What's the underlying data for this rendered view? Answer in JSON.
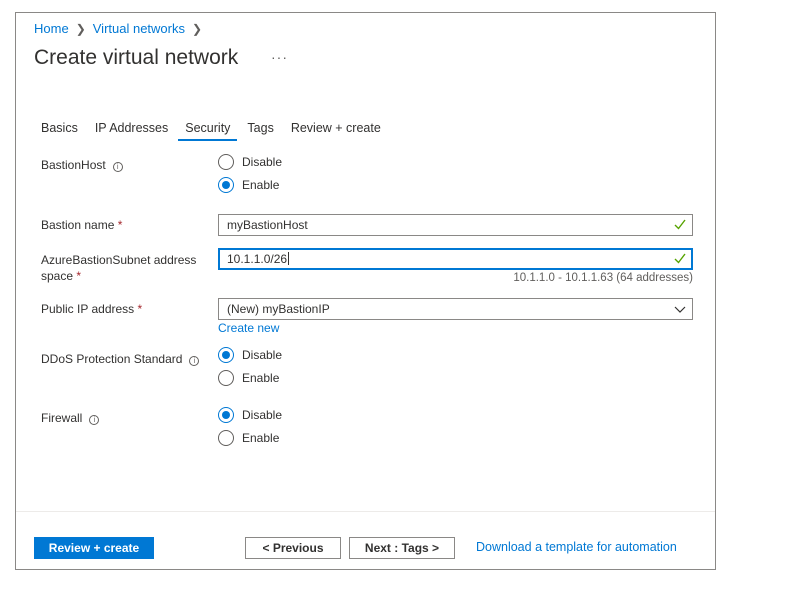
{
  "breadcrumb": {
    "home": "Home",
    "virtual_networks": "Virtual networks"
  },
  "page": {
    "title": "Create virtual network",
    "more": "···"
  },
  "tabs": [
    {
      "label": "Basics"
    },
    {
      "label": "IP Addresses"
    },
    {
      "label": "Security",
      "active": true
    },
    {
      "label": "Tags"
    },
    {
      "label": "Review + create"
    }
  ],
  "bastion_host": {
    "label": "BastionHost",
    "options": [
      "Disable",
      "Enable"
    ],
    "selected": "Enable"
  },
  "bastion_name": {
    "label": "Bastion name",
    "required_mark": "*",
    "value": "myBastionHost"
  },
  "bastion_subnet": {
    "label_line1": "AzureBastionSubnet address",
    "label_line2": "space",
    "required_mark": "*",
    "value": "10.1.1.0/26",
    "hint": "10.1.1.0 - 10.1.1.63 (64 addresses)"
  },
  "public_ip": {
    "label": "Public IP address",
    "required_mark": "*",
    "value": "(New) myBastionIP",
    "create_new": "Create new"
  },
  "ddos": {
    "label": "DDoS Protection Standard",
    "options": [
      "Disable",
      "Enable"
    ],
    "selected": "Disable"
  },
  "firewall": {
    "label": "Firewall",
    "options": [
      "Disable",
      "Enable"
    ],
    "selected": "Disable"
  },
  "footer": {
    "review_create": "Review + create",
    "previous": "< Previous",
    "next": "Next : Tags >",
    "download": "Download a template for automation"
  },
  "colors": {
    "accent": "#0078d4",
    "success": "#57a300",
    "required": "#a4262c"
  },
  "icons": {
    "info": "info-icon",
    "check": "checkmark-icon",
    "dropdown": "chevron-down-icon",
    "breadcrumb_sep": "chevron-right-icon"
  }
}
